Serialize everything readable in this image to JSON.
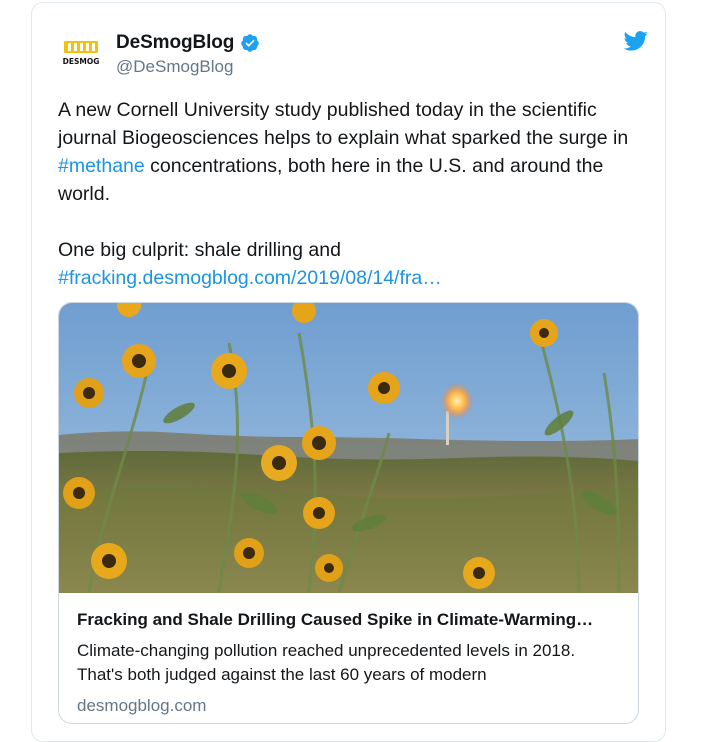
{
  "tweet": {
    "author": {
      "display_name": "DeSmogBlog",
      "handle": "@DeSmogBlog",
      "avatar_text": "DESMOG",
      "verified": true
    },
    "text": {
      "line1_prefix": "A new Cornell University study published today in the scientific journal Biogeosciences helps to explain what sparked the surge in ",
      "hashtag_methane": "#methane",
      "line1_suffix": " concentrations, both here in the U.S. and around the world.",
      "line2_prefix": "One big culprit: shale drilling and ",
      "hashtag_fracking_link": "#fracking.desmogblog.com/2019/08/14/fra…"
    },
    "card": {
      "title": "Fracking and Shale Drilling Caused Spike in Climate-Warming…",
      "description": "Climate-changing pollution reached unprecedented levels in 2018. That's both judged against the last 60 years of modern",
      "domain": "desmogblog.com"
    }
  },
  "colors": {
    "link_blue": "#1b95e0",
    "twitter_blue": "#1da1f2",
    "verified_blue": "#1da1f2",
    "secondary_text": "#657786",
    "logo_yellow": "#f4c20d"
  },
  "icons": {
    "bird": "twitter-bird-icon",
    "verified": "verified-badge-icon"
  }
}
